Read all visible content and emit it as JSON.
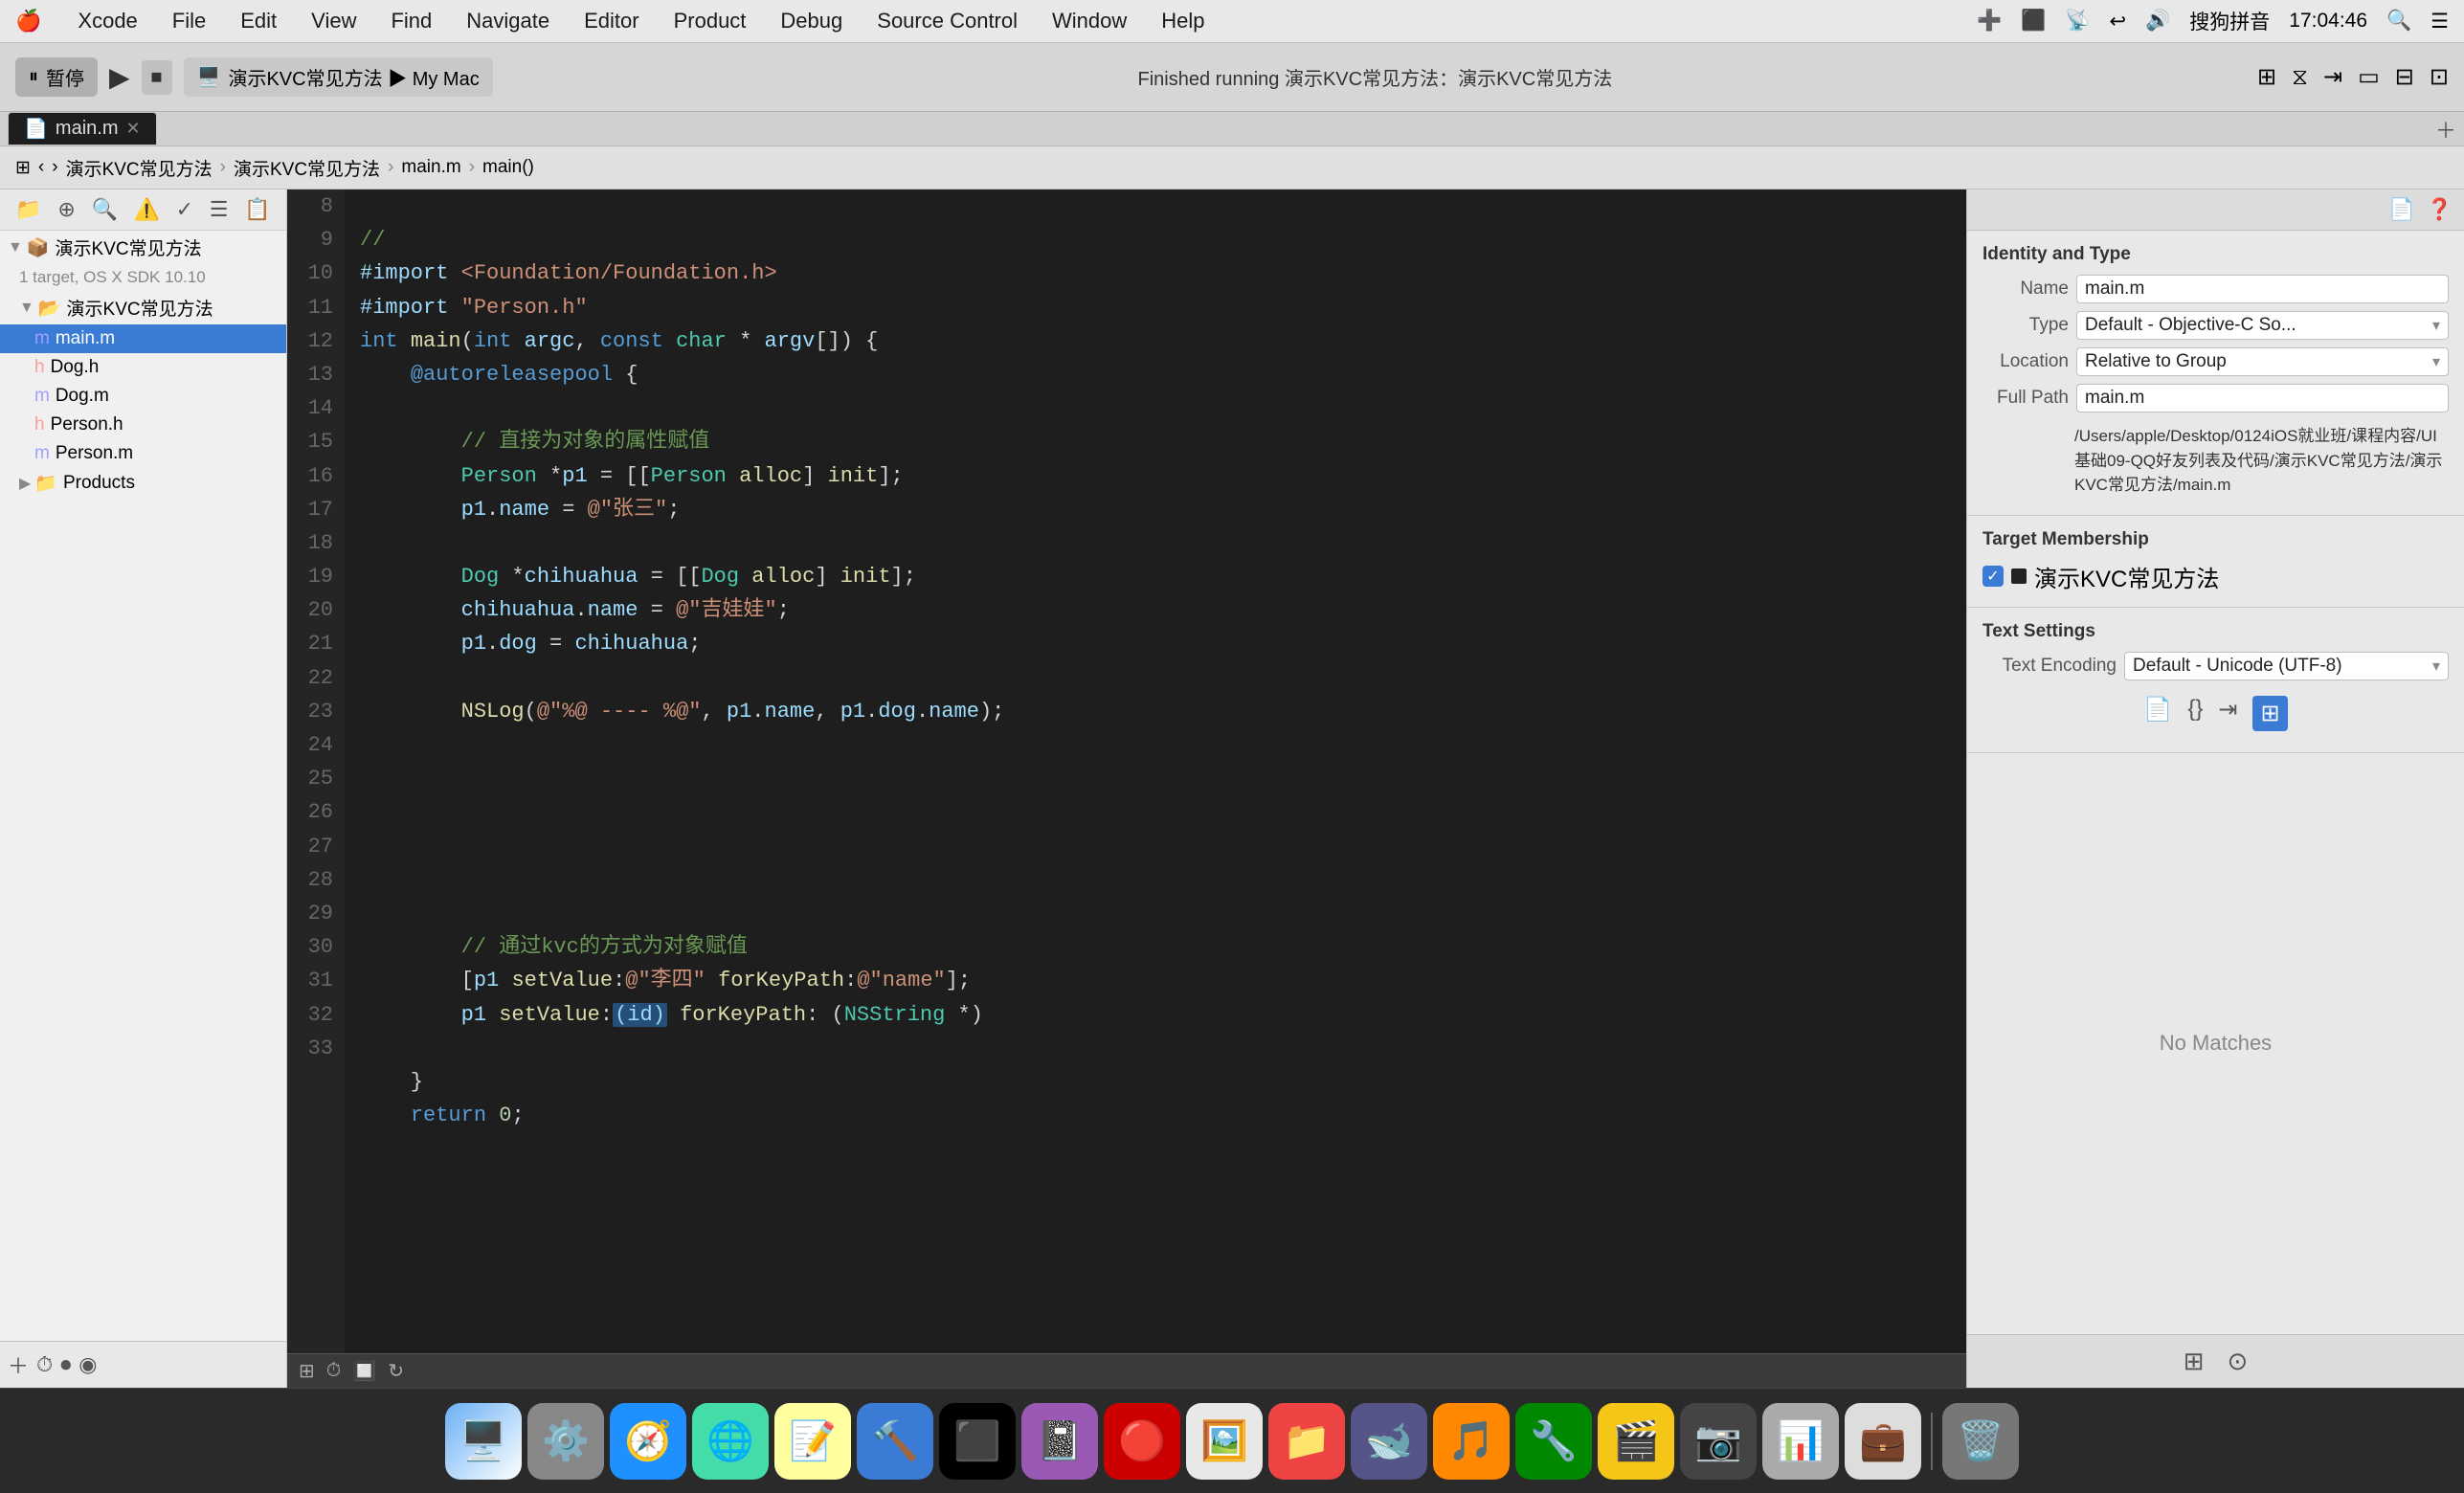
{
  "menubar": {
    "apple": "🍎",
    "items": [
      "Xcode",
      "File",
      "Edit",
      "View",
      "Find",
      "Navigate",
      "Editor",
      "Product",
      "Debug",
      "Source Control",
      "Window",
      "Help"
    ],
    "right": {
      "time": "17:04:46",
      "input_method": "搜狗拼音"
    }
  },
  "toolbar": {
    "pause_label": "暂停",
    "device_label": "演示KVC常见方法 ▶ My Mac",
    "status": "Finished running 演示KVC常见方法：演示KVC常见方法"
  },
  "breadcrumb": {
    "items": [
      "演示KVC常见方法",
      "演示KVC常见方法",
      "main.m",
      "main()"
    ]
  },
  "tab": {
    "label": "main.m"
  },
  "sidebar": {
    "project_name": "演示KVC常见方法",
    "project_target": "1 target, OS X SDK 10.10",
    "group_name": "演示KVC常见方法",
    "files": [
      {
        "name": "main.m",
        "type": "m",
        "indent": 3,
        "selected": true
      },
      {
        "name": "Dog.h",
        "type": "h",
        "indent": 3
      },
      {
        "name": "Dog.m",
        "type": "m",
        "indent": 3
      },
      {
        "name": "Person.h",
        "type": "h",
        "indent": 3
      },
      {
        "name": "Person.m",
        "type": "m",
        "indent": 3
      }
    ],
    "products": "Products"
  },
  "code": {
    "lines": [
      {
        "num": 8,
        "content": "//"
      },
      {
        "num": 9,
        "content": "#import <Foundation/Foundation.h>"
      },
      {
        "num": 10,
        "content": "#import \"Person.h\""
      },
      {
        "num": 11,
        "content": "int main(int argc, const char * argv[]) {"
      },
      {
        "num": 12,
        "content": "    @autoreleasepool {"
      },
      {
        "num": 13,
        "content": ""
      },
      {
        "num": 14,
        "content": "        // 直接为对象的属性赋值"
      },
      {
        "num": 15,
        "content": "        Person *p1 = [[Person alloc] init];"
      },
      {
        "num": 16,
        "content": "        p1.name = @\"张三\";"
      },
      {
        "num": 17,
        "content": ""
      },
      {
        "num": 18,
        "content": "        Dog *chihuahua = [[Dog alloc] init];"
      },
      {
        "num": 19,
        "content": "        chihuahua.name = @\"吉娃娃\";"
      },
      {
        "num": 20,
        "content": "        p1.dog = chihuahua;"
      },
      {
        "num": 21,
        "content": ""
      },
      {
        "num": 22,
        "content": "        NSLog(@\"%@ ---- %@\", p1.name, p1.dog.name);"
      },
      {
        "num": 23,
        "content": ""
      },
      {
        "num": 24,
        "content": ""
      },
      {
        "num": 25,
        "content": ""
      },
      {
        "num": 26,
        "content": ""
      },
      {
        "num": 27,
        "content": "        // 通过kvc的方式为对象赋值"
      },
      {
        "num": 28,
        "content": "        [p1 setValue:@\"李四\" forKeyPath:@\"name\"];"
      },
      {
        "num": 29,
        "content": "        p1 setValue:(id) forKeyPath: (NSString *)"
      },
      {
        "num": 30,
        "content": ""
      },
      {
        "num": 31,
        "content": ""
      },
      {
        "num": 32,
        "content": "    }"
      },
      {
        "num": 33,
        "content": "    return 0;"
      }
    ]
  },
  "right_panel": {
    "section_identity": "Identity and Type",
    "name_label": "Name",
    "name_value": "main.m",
    "type_label": "Type",
    "type_value": "Default - Objective-C So...",
    "location_label": "Location",
    "location_value": "Relative to Group",
    "path_label": "Full Path",
    "path_value": "main.m",
    "full_path": "/Users/apple/Desktop/0124iOS就业班/课程内容/UI基础09-QQ好友列表及代码/演示KVC常见方法/演示KVC常见方法/main.m",
    "section_target": "Target Membership",
    "target_name": "演示KVC常见方法",
    "section_text": "Text Settings",
    "text_encoding_label": "Text Encoding",
    "text_encoding_value": "Default - Unicode (UTF-8)",
    "no_matches": "No Matches"
  },
  "dock": {
    "icons": [
      "🖥️",
      "⚙️",
      "🧭",
      "💾",
      "📝",
      "📋",
      "🔴",
      "📓",
      "🖥️",
      "📁",
      "🔧",
      "📦",
      "🎵",
      "🎬",
      "📷",
      "📱",
      "💼",
      "📊",
      "🗑️"
    ]
  }
}
